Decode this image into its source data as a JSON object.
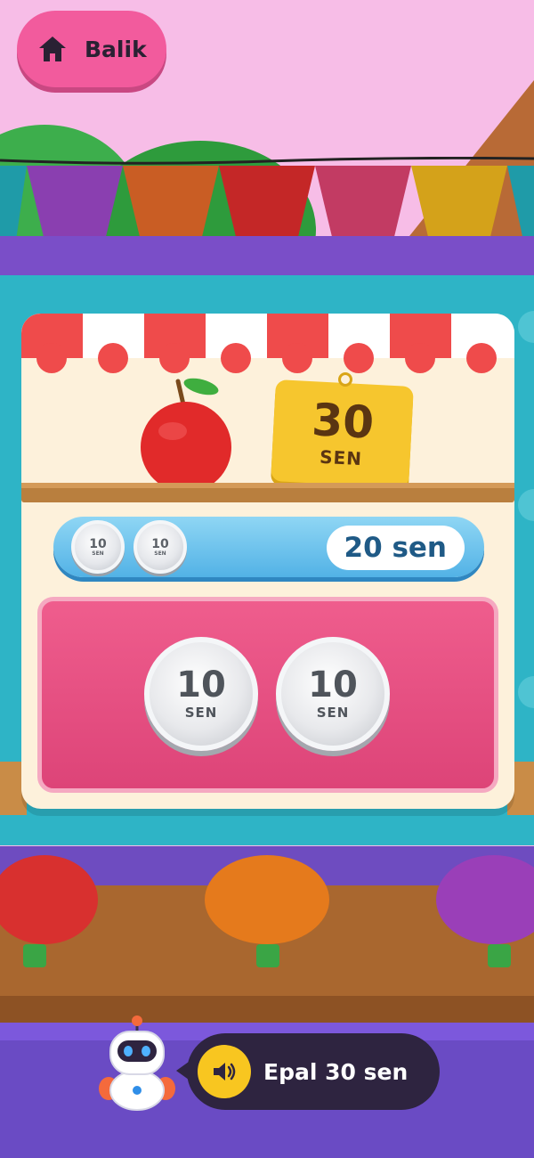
{
  "header": {
    "back_label": "Balik",
    "back_icon": "home-icon"
  },
  "item": {
    "name": "apple",
    "price_amount": "30",
    "price_unit": "SEN"
  },
  "paid": {
    "coins": [
      {
        "value": "10",
        "unit": "SEN"
      },
      {
        "value": "10",
        "unit": "SEN"
      }
    ],
    "total_label": "20 sen"
  },
  "tray": {
    "coins": [
      {
        "value": "10",
        "unit": "SEN"
      },
      {
        "value": "10",
        "unit": "SEN"
      }
    ]
  },
  "narrator": {
    "speaker_icon": "speaker-icon",
    "message": "Epal 30 sen"
  },
  "colors": {
    "back_button": "#f25b9d",
    "price_tag": "#f6c62e",
    "tray": "#e94f83",
    "paid_bar": "#62bfea",
    "speech_bubble": "#2e2440",
    "speaker_button": "#f8c620"
  }
}
